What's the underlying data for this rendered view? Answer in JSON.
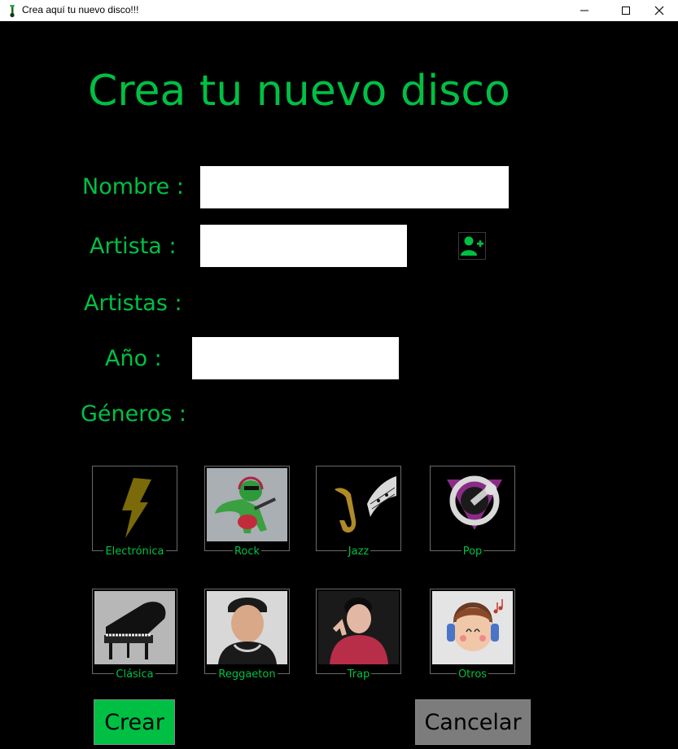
{
  "window": {
    "title": "Crea aquí tu nuevo disco!!!"
  },
  "heading": "Crea tu nuevo disco",
  "form": {
    "nombre_label": "Nombre :",
    "nombre_value": "",
    "artista_label": "Artista :",
    "artista_value": "",
    "artistas_label": "Artistas :",
    "anio_label": "Año :",
    "anio_value": "",
    "generos_label": "Géneros :"
  },
  "genres": [
    {
      "label": "Electrónica",
      "icon": "lightning-bolt-icon"
    },
    {
      "label": "Rock",
      "icon": "dinosaur-guitar-icon"
    },
    {
      "label": "Jazz",
      "icon": "saxophone-icon"
    },
    {
      "label": "Pop",
      "icon": "pop-music-microphone-icon"
    },
    {
      "label": "Clásica",
      "icon": "grand-piano-icon"
    },
    {
      "label": "Reggaeton",
      "icon": "reggaeton-artist-icon"
    },
    {
      "label": "Trap",
      "icon": "trap-artist-icon"
    },
    {
      "label": "Otros",
      "icon": "headphones-boy-icon"
    }
  ],
  "buttons": {
    "create": "Crear",
    "cancel": "Cancelar"
  },
  "colors": {
    "accent": "#00c044",
    "background": "#000000",
    "cancel": "#7c7c7c"
  }
}
